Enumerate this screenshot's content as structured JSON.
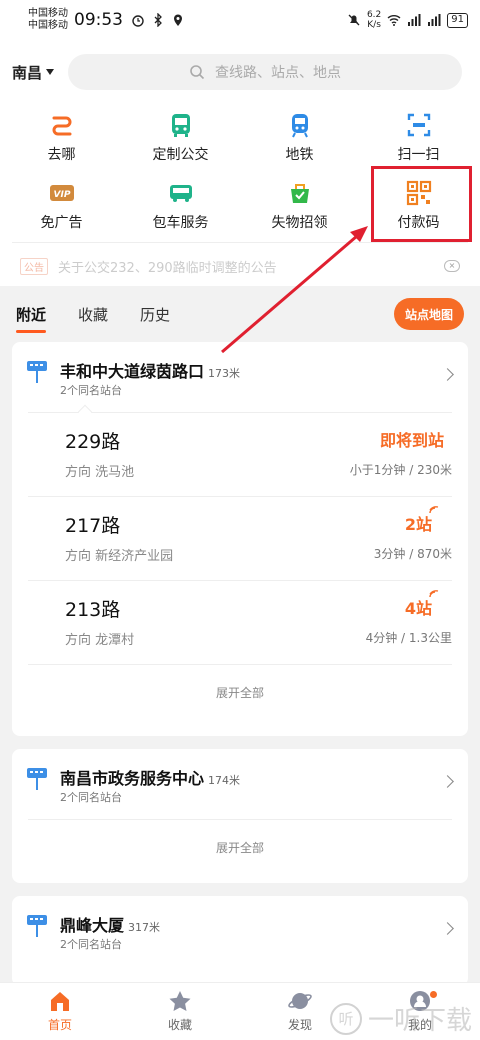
{
  "status_bar": {
    "carrier_1": "中国移动",
    "carrier_2": "中国移动",
    "time": "09:53",
    "net_speed": "6.2",
    "net_speed_unit": "K/s",
    "battery": "91"
  },
  "header": {
    "city": "南昌",
    "search_placeholder": "查线路、站点、地点"
  },
  "grid": [
    {
      "label": "去哪",
      "icon": "route-icon"
    },
    {
      "label": "定制公交",
      "icon": "bus-icon"
    },
    {
      "label": "地铁",
      "icon": "metro-icon"
    },
    {
      "label": "扫一扫",
      "icon": "scan-icon"
    },
    {
      "label": "免广告",
      "icon": "vip-icon"
    },
    {
      "label": "包车服务",
      "icon": "charter-bus-icon"
    },
    {
      "label": "失物招领",
      "icon": "lost-found-icon"
    },
    {
      "label": "付款码",
      "icon": "qr-code-icon"
    }
  ],
  "notice": {
    "tag": "公告",
    "text": "关于公交232、290路临时调整的公告"
  },
  "tabs": {
    "items": [
      "附近",
      "收藏",
      "历史"
    ],
    "active": "附近",
    "map_button": "站点地图"
  },
  "stops": [
    {
      "name": "丰和中大道绿茵路口",
      "distance": "173米",
      "sub": "2个同名站台",
      "routes": [
        {
          "name": "229路",
          "direction": "方向 洗马池",
          "status": "即将到站",
          "eta": "小于1分钟 / 230米"
        },
        {
          "name": "217路",
          "direction": "方向 新经济产业园",
          "status": "2站",
          "eta": "3分钟 / 870米"
        },
        {
          "name": "213路",
          "direction": "方向 龙潭村",
          "status": "4站",
          "eta": "4分钟 / 1.3公里"
        }
      ],
      "expand": "展开全部"
    },
    {
      "name": "南昌市政务服务中心",
      "distance": "174米",
      "sub": "2个同名站台",
      "expand": "展开全部"
    },
    {
      "name": "鼎峰大厦",
      "distance": "317米",
      "sub": "2个同名站台"
    }
  ],
  "bottom_nav": [
    {
      "label": "首页",
      "icon": "home-icon",
      "active": true
    },
    {
      "label": "收藏",
      "icon": "star-icon",
      "active": false
    },
    {
      "label": "发现",
      "icon": "planet-icon",
      "active": false
    },
    {
      "label": "我的",
      "icon": "user-icon",
      "active": false
    }
  ],
  "watermark": {
    "glyph": "听",
    "text": "一听下载"
  },
  "colors": {
    "accent": "#f66c26",
    "highlight": "#e02030"
  }
}
